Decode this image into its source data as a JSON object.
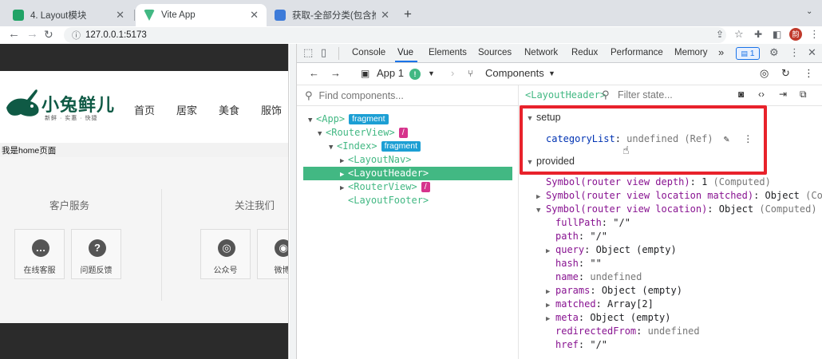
{
  "browser": {
    "tabs": [
      {
        "title": "4. Layout模块",
        "favicon_color": "#21a366"
      },
      {
        "title": "Vite App",
        "favicon_color": "#42b883"
      },
      {
        "title": "获取-全部分类(包含推荐商品) - ",
        "favicon_color": "#3d7bd9"
      }
    ],
    "url": "127.0.0.1:5173",
    "profile_initial": "韵"
  },
  "page": {
    "logo": {
      "text": "小兔鲜儿",
      "sub": "新鲜 · 实惠 · 快捷"
    },
    "menu": [
      "首页",
      "居家",
      "美食",
      "服饰"
    ],
    "home_text": "我是home页面",
    "footer": {
      "service_title": "客户服务",
      "follow_title": "关注我们",
      "service_items": [
        "在线客服",
        "问题反馈"
      ],
      "follow_items": [
        "公众号",
        "微博"
      ]
    }
  },
  "devtools": {
    "tabs": [
      "Console",
      "Vue",
      "Elements",
      "Sources",
      "Network",
      "Redux",
      "Performance",
      "Memory"
    ],
    "more": "»",
    "issues_count": "1",
    "vue": {
      "app_label": "App 1",
      "components_label": "Components",
      "find_placeholder": "Find components...",
      "selected_component": "<LayoutHeader>",
      "filter_placeholder": "Filter state..."
    },
    "tree": [
      {
        "tag": "<App>",
        "badge": "fragment",
        "badge_type": "frag",
        "arrow": "▼",
        "indent": 0
      },
      {
        "tag": "<RouterView>",
        "badge": "/",
        "badge_type": "route",
        "arrow": "▼",
        "indent": 1
      },
      {
        "tag": "<Index>",
        "badge": "fragment",
        "badge_type": "frag",
        "arrow": "▼",
        "indent": 2
      },
      {
        "tag": "<LayoutNav>",
        "badge": "",
        "badge_type": "",
        "arrow": "▶",
        "indent": 3
      },
      {
        "tag": "<LayoutHeader>",
        "badge": "",
        "badge_type": "",
        "arrow": "▶",
        "indent": 3,
        "selected": true
      },
      {
        "tag": "<RouterView>",
        "badge": "/",
        "badge_type": "route",
        "arrow": "▶",
        "indent": 3
      },
      {
        "tag": "<LayoutFooter>",
        "badge": "",
        "badge_type": "",
        "arrow": "",
        "indent": 3
      }
    ],
    "state": {
      "setup_title": "setup",
      "setup": {
        "key": "categoryList",
        "value": "undefined",
        "type": "(Ref)"
      },
      "provided_title": "provided",
      "provided": [
        {
          "key": "Symbol(router view depth)",
          "value": "1",
          "extra": "(Computed)",
          "arrow": "",
          "indent": 0
        },
        {
          "key": "Symbol(router view location matched)",
          "value": "Object",
          "extra": "(Co",
          "arrow": "▶",
          "indent": 0
        },
        {
          "key": "Symbol(router view location)",
          "value": "Object",
          "extra": "(Computed)",
          "arrow": "▼",
          "indent": 0
        },
        {
          "key": "fullPath",
          "value": "\"/\"",
          "extra": "",
          "arrow": "",
          "indent": 1
        },
        {
          "key": "path",
          "value": "\"/\"",
          "extra": "",
          "arrow": "",
          "indent": 1
        },
        {
          "key": "query",
          "value": "Object (empty)",
          "extra": "",
          "arrow": "▶",
          "indent": 1
        },
        {
          "key": "hash",
          "value": "\"\"",
          "extra": "",
          "arrow": "",
          "indent": 1
        },
        {
          "key": "name",
          "value": "undefined",
          "extra": "",
          "arrow": "",
          "indent": 1,
          "grey": true
        },
        {
          "key": "params",
          "value": "Object (empty)",
          "extra": "",
          "arrow": "▶",
          "indent": 1
        },
        {
          "key": "matched",
          "value": "Array[2]",
          "extra": "",
          "arrow": "▶",
          "indent": 1
        },
        {
          "key": "meta",
          "value": "Object (empty)",
          "extra": "",
          "arrow": "▶",
          "indent": 1
        },
        {
          "key": "redirectedFrom",
          "value": "undefined",
          "extra": "",
          "arrow": "",
          "indent": 1,
          "grey": true
        },
        {
          "key": "href",
          "value": "\"/\"",
          "extra": "",
          "arrow": "",
          "indent": 1
        }
      ]
    }
  },
  "colors": {
    "vue_green": "#42b883",
    "highlight_red": "#e8222b",
    "brand_green": "#0f5a45"
  }
}
